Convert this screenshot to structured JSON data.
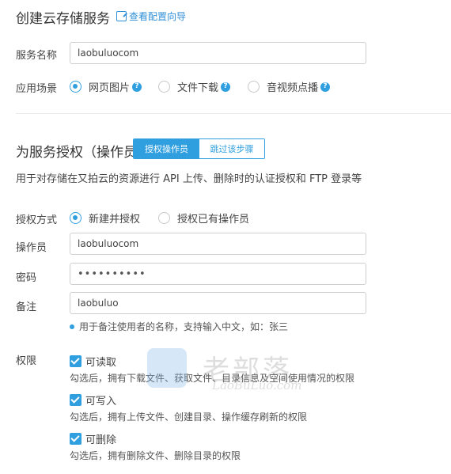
{
  "header": {
    "title": "创建云存储服务",
    "guide_link": "查看配置向导",
    "guide_icon": "external-guide-icon"
  },
  "service": {
    "name_label": "服务名称",
    "name_value": "laobuluocom",
    "scene_label": "应用场景",
    "scenes": [
      {
        "label": "网页图片",
        "selected": true
      },
      {
        "label": "文件下载",
        "selected": false
      },
      {
        "label": "音视频点播",
        "selected": false
      }
    ],
    "help_glyph": "?"
  },
  "auth": {
    "title": "为服务授权（操作员）",
    "tab_authorize": "授权操作员",
    "tab_skip": "跳过该步骤",
    "description": "用于对存储在又拍云的资源进行 API 上传、删除时的认证授权和 FTP 登录等",
    "method_label": "授权方式",
    "methods": [
      {
        "label": "新建并授权",
        "selected": true
      },
      {
        "label": "授权已有操作员",
        "selected": false
      }
    ],
    "operator_label": "操作员",
    "operator_value": "laobuluocom",
    "password_label": "密码",
    "password_value": "••••••••••",
    "remark_label": "备注",
    "remark_value": "laobuluo",
    "remark_hint": "用于备注使用者的名称，支持输入中文，如：张三"
  },
  "permissions": {
    "label": "权限",
    "items": [
      {
        "label": "可读取",
        "checked": true,
        "desc": "勾选后，拥有下载文件、获取文件、目录信息及空间使用情况的权限"
      },
      {
        "label": "可写入",
        "checked": true,
        "desc": "勾选后，拥有上传文件、创建目录、操作缓存刷新的权限"
      },
      {
        "label": "可删除",
        "checked": true,
        "desc": "勾选后，拥有删除文件、删除目录的权限"
      }
    ]
  },
  "watermark": {
    "cn": "老部落",
    "en": "LaoBuLuo.com"
  },
  "colors": {
    "accent": "#2f9fe0",
    "link": "#2f8fd8"
  }
}
